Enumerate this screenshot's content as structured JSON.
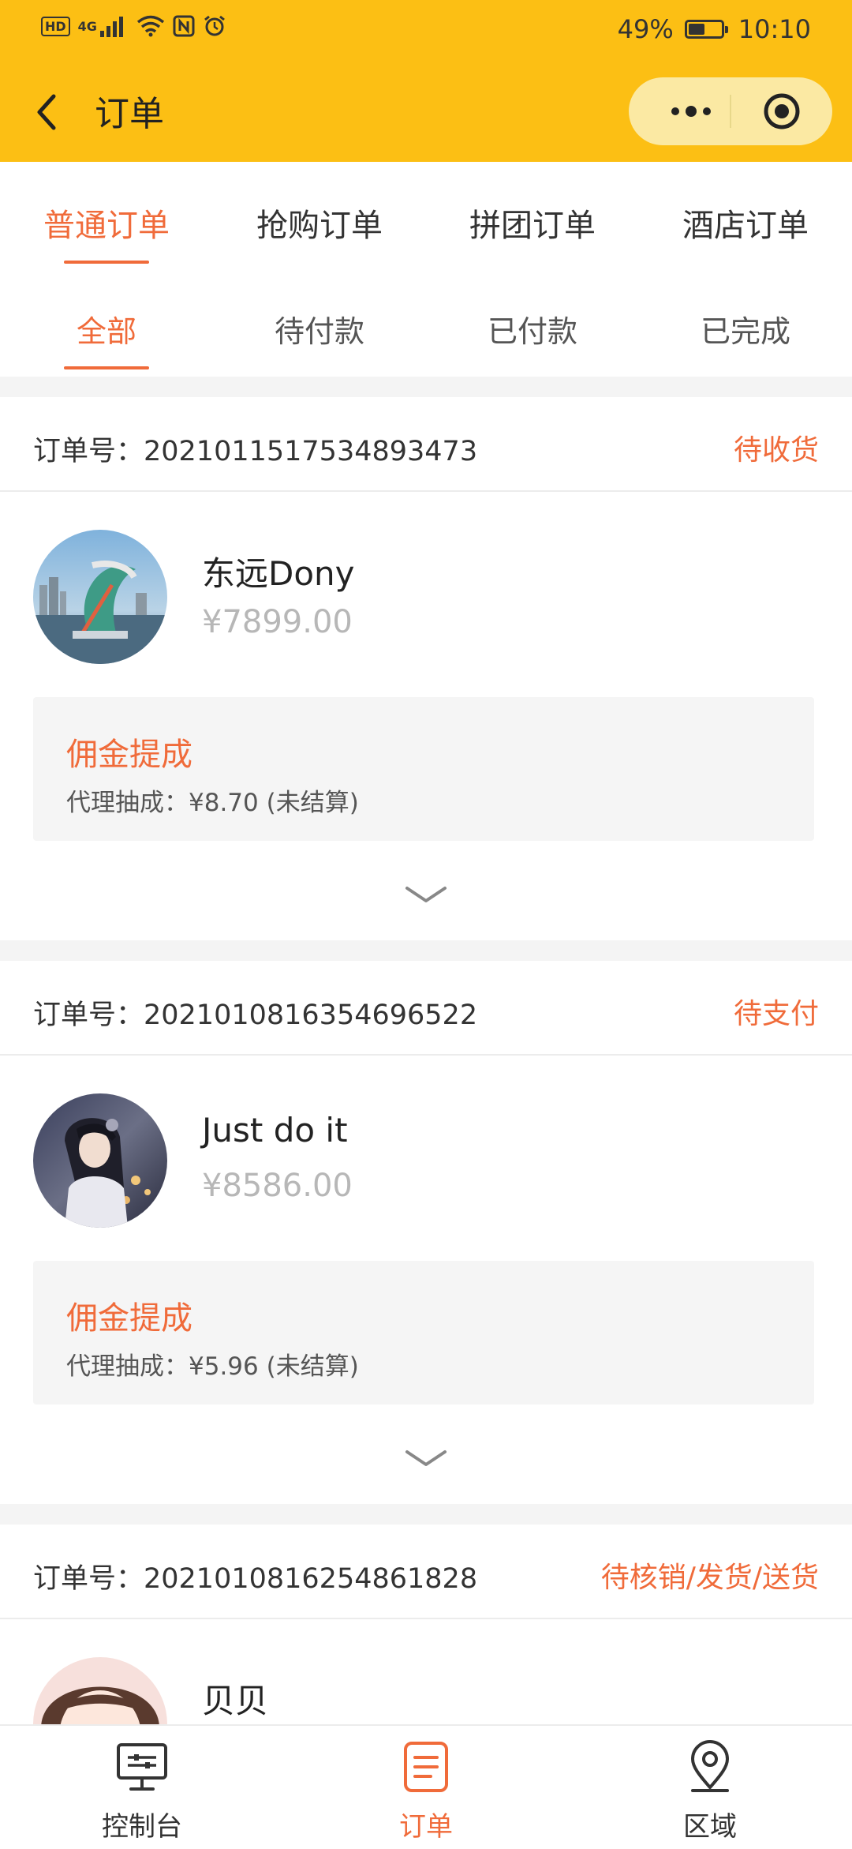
{
  "status_bar": {
    "network": "4G",
    "hd": "HD",
    "battery": "49%",
    "battery_level": 0.49,
    "time": "10:10"
  },
  "navbar": {
    "title": "订单"
  },
  "order_type_tabs": [
    {
      "label": "普通订单",
      "active": true
    },
    {
      "label": "抢购订单",
      "active": false
    },
    {
      "label": "拼团订单",
      "active": false
    },
    {
      "label": "酒店订单",
      "active": false
    }
  ],
  "status_tabs": [
    {
      "label": "全部",
      "active": true
    },
    {
      "label": "待付款",
      "active": false
    },
    {
      "label": "已付款",
      "active": false
    },
    {
      "label": "已完成",
      "active": false
    }
  ],
  "orders": [
    {
      "order_no": "订单号：2021011517534893473",
      "status": "待收货",
      "user": "东远Dony",
      "price": "¥7899.00",
      "commission_title": "佣金提成",
      "commission_detail": "代理抽成：¥8.70 (未结算)"
    },
    {
      "order_no": "订单号：2021010816354696522",
      "status": "待支付",
      "user": "Just do it",
      "price": "¥8586.00",
      "commission_title": "佣金提成",
      "commission_detail": "代理抽成：¥5.96 (未结算)"
    },
    {
      "order_no": "订单号：2021010816254861828",
      "status": "待核销/发货/送货",
      "user": "贝贝",
      "price": "",
      "commission_title": "",
      "commission_detail": ""
    }
  ],
  "tabbar": [
    {
      "label": "控制台",
      "icon": "monitor-icon",
      "active": false
    },
    {
      "label": "订单",
      "icon": "order-list-icon",
      "active": true
    },
    {
      "label": "区域",
      "icon": "location-pin-icon",
      "active": false
    }
  ],
  "colors": {
    "header": "#fcbf14",
    "accent": "#f06b3a"
  }
}
